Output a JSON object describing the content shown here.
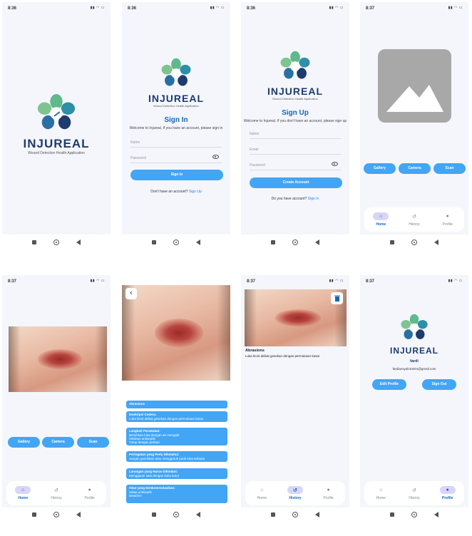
{
  "status": {
    "time_a": "8:36",
    "time_b": "8:37",
    "icons": "▮▮ ◠ ▭"
  },
  "logo": {
    "title": "INJUREAL",
    "subtitle": "Wound Detection Health Application"
  },
  "signin": {
    "title": "Sign In",
    "subtitle": "Welcome to Injureal, If you have an account, please sign in",
    "name_placeholder": "Name",
    "password_placeholder": "Password",
    "button": "Sign In",
    "link_text": "Don't have an account?",
    "link_action": "Sign Up"
  },
  "signup": {
    "title": "Sign Up",
    "subtitle": "Welcome to Injureal, If you don't have an account, please sign up",
    "name_placeholder": "Name",
    "email_placeholder": "Email",
    "password_placeholder": "Password",
    "button": "Create Account",
    "link_text": "Do you have account?",
    "link_action": "Sign In"
  },
  "actions": {
    "gallery": "Gallery",
    "camera": "Camera",
    "scan": "Scan"
  },
  "nav": {
    "home": "Home",
    "history": "History",
    "profile": "Profile"
  },
  "result": {
    "label": "Abrasions",
    "sections": [
      {
        "title": "Deskripsi Cedera:",
        "body": "Luka lecet akibat gesekan dengan permukaan kasar"
      },
      {
        "title": "Langkah Perawatan:",
        "body": "Bersihkan luka dengan air mengalir\nOleskan antiseptik\nTutup dengan perban"
      },
      {
        "title": "Peringatan yang Perlu Diketahui:",
        "body": "Jangan gosokkan atau menggaruk pada luka terbuka"
      },
      {
        "title": "Larangan yang Harus Dihindari:",
        "body": "Menggaruk luka dengan kuku kotor"
      },
      {
        "title": "Obat yang Direkomendasikan:",
        "body": "Salep antiseptik\nBetadine"
      }
    ]
  },
  "history": {
    "title": "Abrasions",
    "description": "Luka lecet akibat gesekan dengan permukaan kasar"
  },
  "profile": {
    "name": "fardi",
    "email": "fardiansyah10401@gmail.com",
    "edit_button": "Edit Profile",
    "signout_button": "Sign Out"
  },
  "colors": {
    "primary": "#42a5f5",
    "title_blue": "#1565c0",
    "logo_navy": "#1d3b6e",
    "nav_active_bg": "#d9d5f7"
  }
}
